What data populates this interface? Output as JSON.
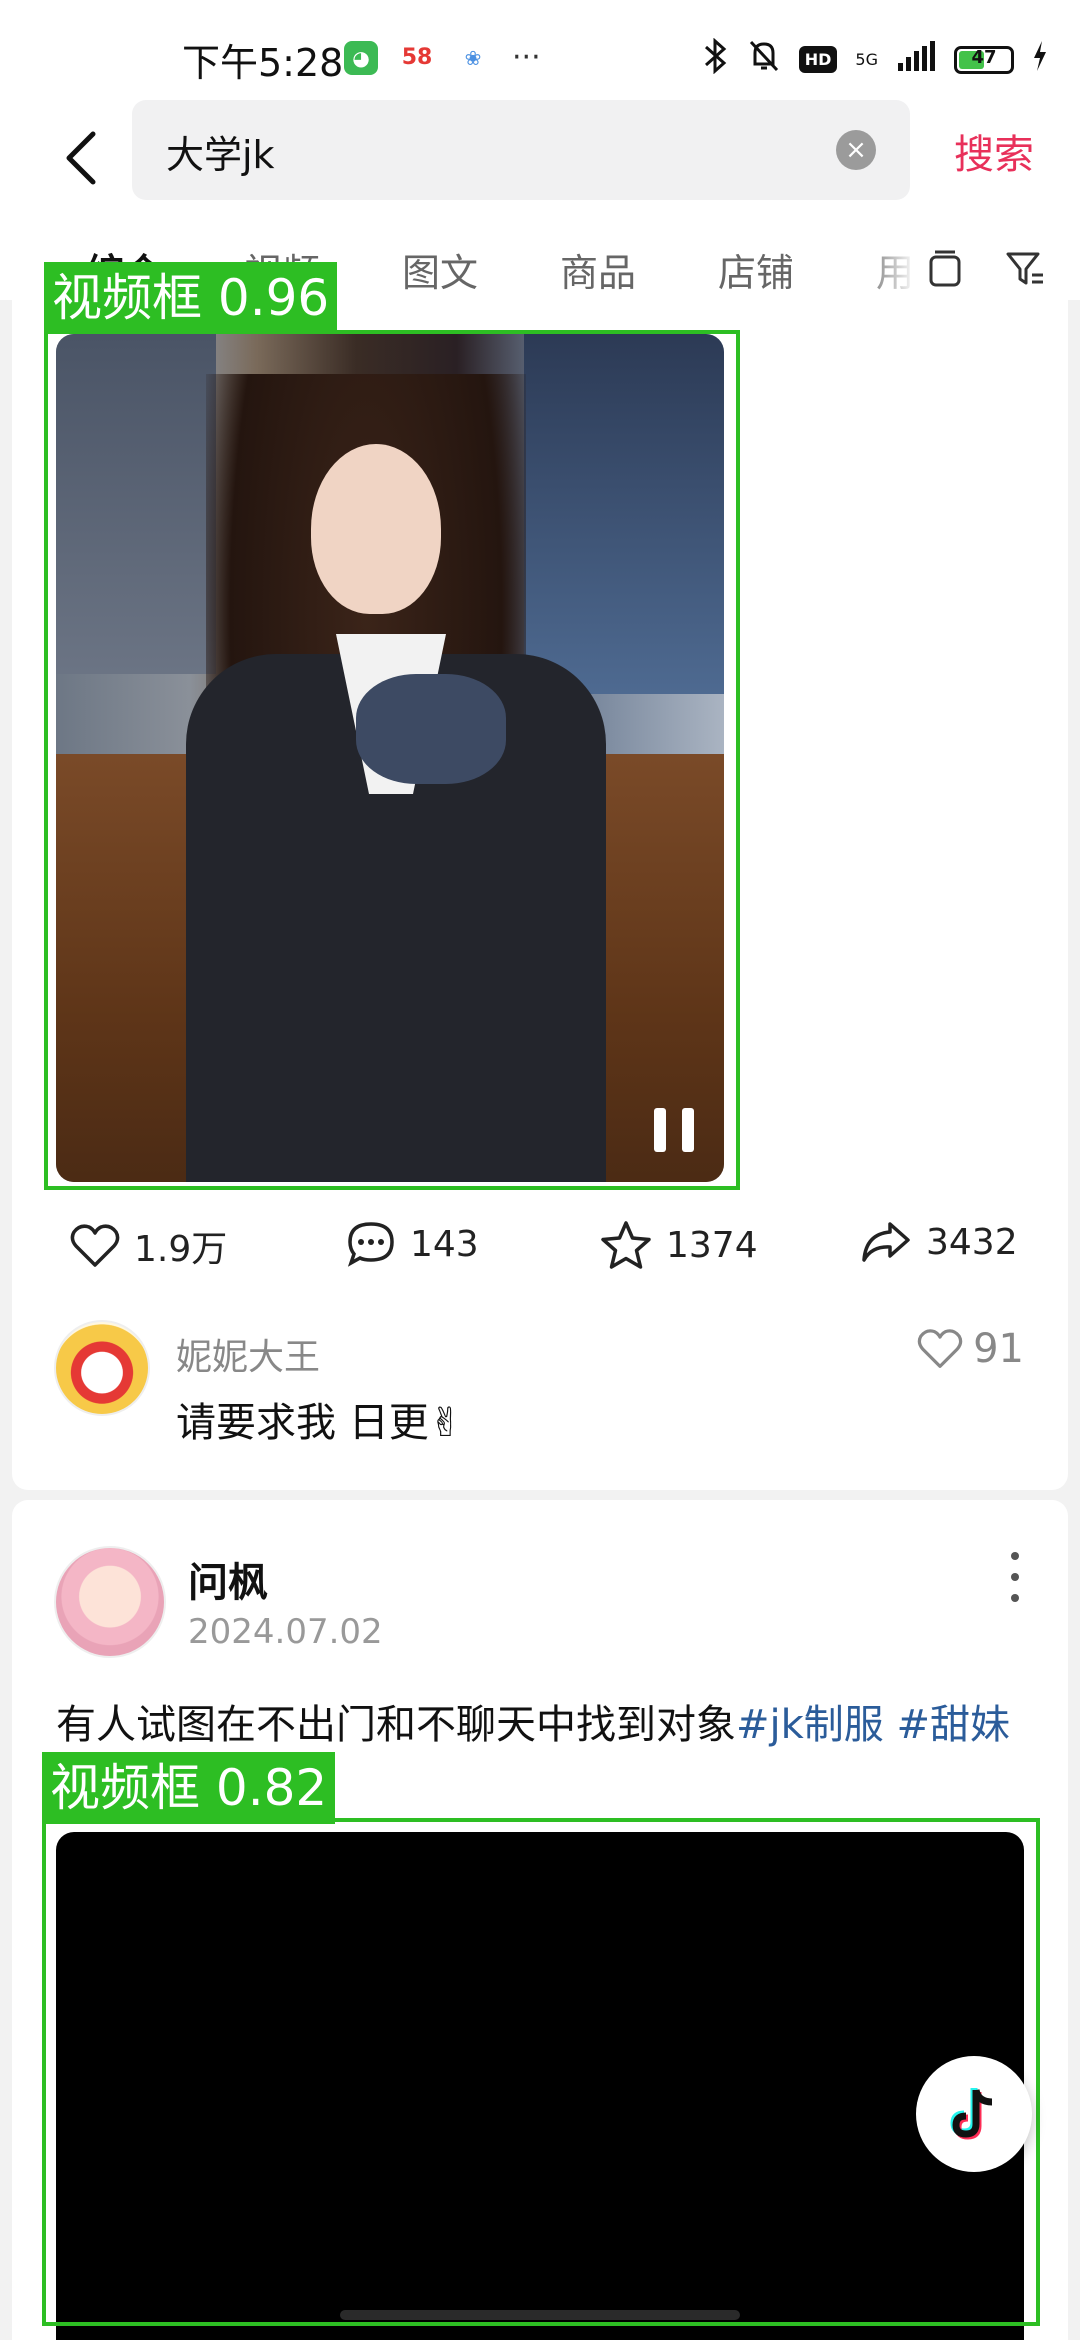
{
  "status_bar": {
    "time": "下午5:28",
    "app_icon_58": "58",
    "more": "···",
    "hd": "HD",
    "net": "5G",
    "battery": "47"
  },
  "search": {
    "query": "大学jk",
    "action_label": "搜索"
  },
  "tabs": [
    {
      "label": "综合",
      "active": true
    },
    {
      "label": "视频",
      "active": false
    },
    {
      "label": "图文",
      "active": false
    },
    {
      "label": "商品",
      "active": false
    },
    {
      "label": "店铺",
      "active": false
    },
    {
      "label": "用",
      "active": false
    }
  ],
  "detections": [
    {
      "label": "视频框 0.96"
    },
    {
      "label": "视频框 0.82"
    }
  ],
  "post1": {
    "likes": "1.9万",
    "comments": "143",
    "favorites": "1374",
    "shares": "3432",
    "top_comment": {
      "user": "妮妮大王",
      "text": "请要求我 日更✌",
      "likes": "91"
    }
  },
  "post2": {
    "author": "问枫",
    "date": "2024.07.02",
    "text": "有人试图在不出门和不聊天中找到对象",
    "hashtags": "#jk制服 #甜妹"
  },
  "colors": {
    "accent": "#e8305a",
    "hashtag": "#2b5c9a",
    "detection": "#2dbe23"
  }
}
